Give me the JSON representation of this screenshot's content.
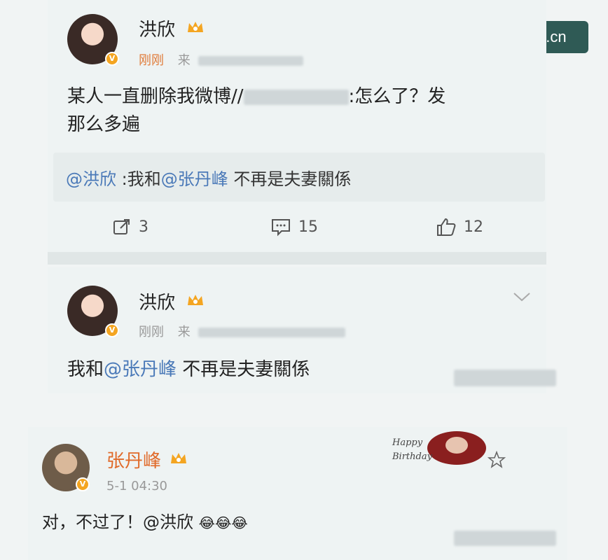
{
  "watermark": "bsport-apple.com.cn",
  "post1": {
    "username": "洪欣",
    "time": "刚刚",
    "source_prefix": "来",
    "text_line1_a": "某人一直删除我微博//",
    "text_line1_b": ":怎么了？发",
    "text_line2": "那么多遍",
    "quote_mention": "@洪欣",
    "quote_text_a": " :我和",
    "quote_mention2": "@张丹峰",
    "quote_text_b": " 不再是夫妻關係",
    "repost_count": "3",
    "comment_count": "15",
    "like_count": "12"
  },
  "post2": {
    "username": "洪欣",
    "time": "刚刚",
    "source_prefix": "来",
    "text_a": "我和",
    "mention": "@张丹峰",
    "text_b": " 不再是夫妻關係"
  },
  "post3": {
    "username": "张丹峰",
    "time": "5-1 04:30",
    "text_a": "对，不过了！",
    "mention": "@洪欣",
    "emoji": "😂😂😂",
    "sticker_text": "Happy Birthday"
  },
  "colors": {
    "mention": "#4a79b8",
    "badge": "#f4a521",
    "watermark_bg": "#2f5a55"
  },
  "icons": [
    "verified-badge-icon",
    "crown-icon",
    "repost-icon",
    "comment-icon",
    "like-icon",
    "chevron-down-icon",
    "star-icon"
  ]
}
